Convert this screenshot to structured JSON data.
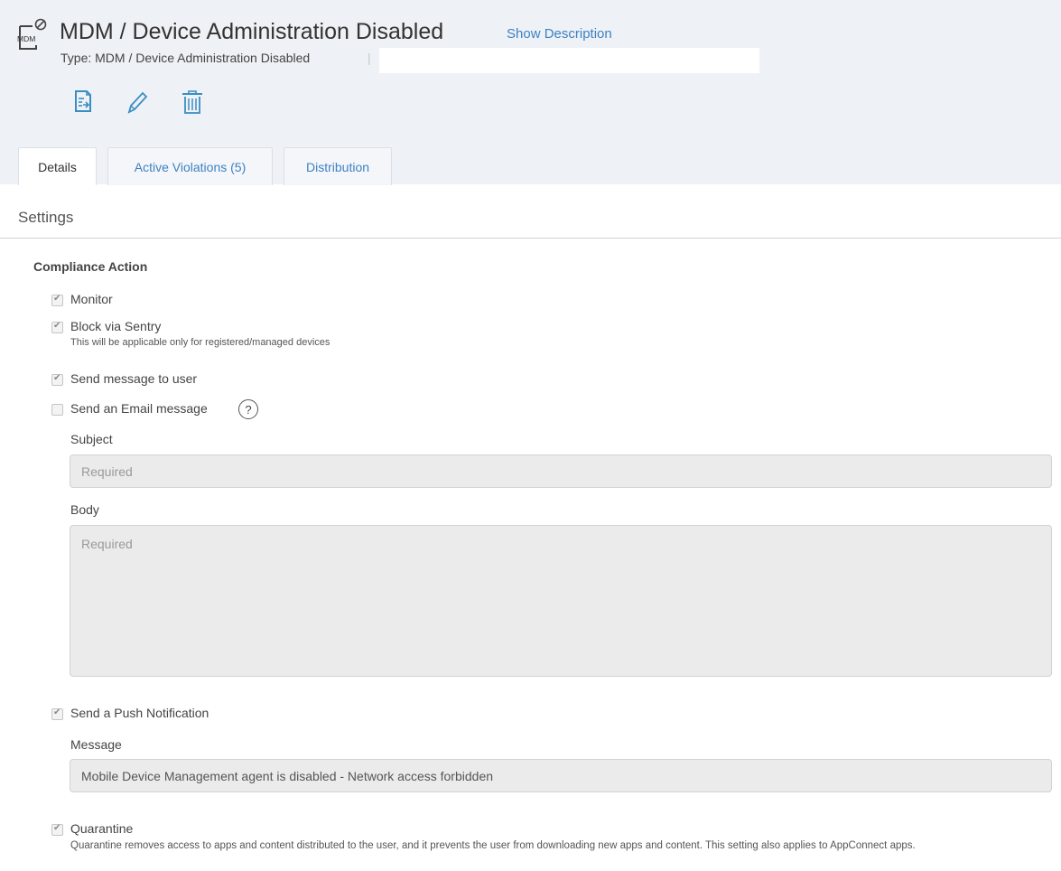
{
  "header": {
    "icon_text": "MDM",
    "title": "MDM / Device Administration Disabled",
    "show_description": "Show Description",
    "type_line": "Type: MDM / Device Administration Disabled",
    "separator": "|",
    "input_value": ""
  },
  "toolbar": {
    "icons": [
      "copy-icon",
      "edit-pencil-icon",
      "delete-trash-icon"
    ]
  },
  "tabs": [
    {
      "label": "Details",
      "active": true
    },
    {
      "label": "Active Violations (5)",
      "active": false
    },
    {
      "label": "Distribution",
      "active": false
    }
  ],
  "settings": {
    "title": "Settings",
    "compliance_action_title": "Compliance Action",
    "monitor": {
      "label": "Monitor",
      "checked": true
    },
    "block_sentry": {
      "label": "Block via Sentry",
      "hint": "This will be applicable only for registered/managed devices",
      "checked": true
    },
    "send_message_user": {
      "label": "Send message to user",
      "checked": true
    },
    "send_email": {
      "label": "Send an Email message",
      "help": "?",
      "checked": false
    },
    "subject": {
      "label": "Subject",
      "placeholder": "Required",
      "value": ""
    },
    "body": {
      "label": "Body",
      "placeholder": "Required",
      "value": ""
    },
    "push_notification": {
      "label": "Send a Push Notification",
      "checked": true
    },
    "message": {
      "label": "Message",
      "value": "Mobile Device Management agent is disabled - Network access forbidden"
    },
    "quarantine": {
      "label": "Quarantine",
      "hint": "Quarantine removes access to apps and content distributed to the user, and it prevents the user from downloading new apps and content. This setting also applies to AppConnect apps.",
      "checked": true
    }
  },
  "colors": {
    "header_bg": "#eef1f5",
    "link": "#3d82c4",
    "field_bg": "#ebebeb"
  }
}
